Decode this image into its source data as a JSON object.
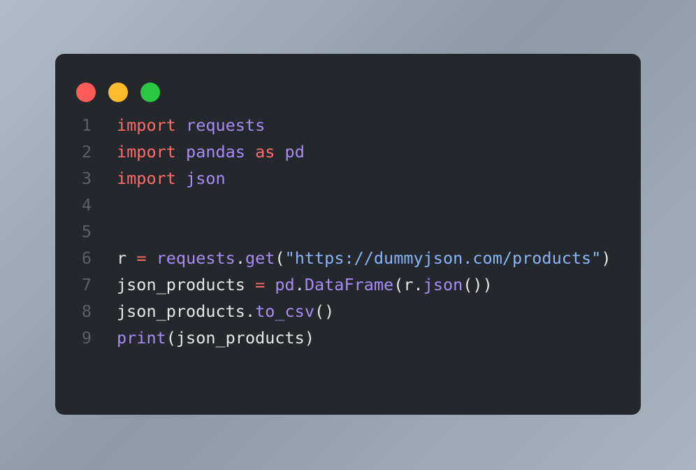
{
  "window": {
    "controls": [
      {
        "name": "close",
        "label": "Close",
        "color": "#fb5b57"
      },
      {
        "name": "minimize",
        "label": "Minimize",
        "color": "#fdbc2d"
      },
      {
        "name": "zoom",
        "label": "Zoom",
        "color": "#28c840"
      }
    ]
  },
  "theme": {
    "card_background": "#24282c",
    "page_background": "#9aa6b2",
    "gutter_color": "#596068",
    "text_color": "#e6e6e6",
    "keyword_color": "#ff6b6b",
    "module_color": "#a98bf5",
    "function_color": "#a98bf5",
    "string_color": "#8ab4f8"
  },
  "editor": {
    "language": "python",
    "line_numbers": [
      "1",
      "2",
      "3",
      "4",
      "5",
      "6",
      "7",
      "8",
      "9"
    ],
    "lines": [
      {
        "number": "1",
        "text": "import requests",
        "tokens": [
          {
            "t": "import",
            "c": "tok-kw"
          },
          {
            "t": " ",
            "c": "tok-plain"
          },
          {
            "t": "requests",
            "c": "tok-module"
          }
        ]
      },
      {
        "number": "2",
        "text": "import pandas as pd",
        "tokens": [
          {
            "t": "import",
            "c": "tok-kw"
          },
          {
            "t": " ",
            "c": "tok-plain"
          },
          {
            "t": "pandas",
            "c": "tok-module"
          },
          {
            "t": " ",
            "c": "tok-plain"
          },
          {
            "t": "as",
            "c": "tok-kw"
          },
          {
            "t": " ",
            "c": "tok-plain"
          },
          {
            "t": "pd",
            "c": "tok-module"
          }
        ]
      },
      {
        "number": "3",
        "text": "import json",
        "tokens": [
          {
            "t": "import",
            "c": "tok-kw"
          },
          {
            "t": " ",
            "c": "tok-plain"
          },
          {
            "t": "json",
            "c": "tok-module"
          }
        ]
      },
      {
        "number": "4",
        "text": "",
        "tokens": []
      },
      {
        "number": "5",
        "text": "",
        "tokens": []
      },
      {
        "number": "6",
        "text": "r = requests.get(\"https://dummyjson.com/products\")",
        "tokens": [
          {
            "t": "r",
            "c": "tok-plain"
          },
          {
            "t": " ",
            "c": "tok-plain"
          },
          {
            "t": "=",
            "c": "tok-op"
          },
          {
            "t": " ",
            "c": "tok-plain"
          },
          {
            "t": "requests",
            "c": "tok-module"
          },
          {
            "t": ".",
            "c": "tok-punct"
          },
          {
            "t": "get",
            "c": "tok-fn"
          },
          {
            "t": "(",
            "c": "tok-punct"
          },
          {
            "t": "\"https://dummyjson.com/products\"",
            "c": "tok-str"
          },
          {
            "t": ")",
            "c": "tok-punct"
          }
        ]
      },
      {
        "number": "7",
        "text": "json_products = pd.DataFrame(r.json())",
        "tokens": [
          {
            "t": "json_products",
            "c": "tok-plain"
          },
          {
            "t": " ",
            "c": "tok-plain"
          },
          {
            "t": "=",
            "c": "tok-op"
          },
          {
            "t": " ",
            "c": "tok-plain"
          },
          {
            "t": "pd",
            "c": "tok-module"
          },
          {
            "t": ".",
            "c": "tok-punct"
          },
          {
            "t": "DataFrame",
            "c": "tok-fn"
          },
          {
            "t": "(",
            "c": "tok-punct"
          },
          {
            "t": "r",
            "c": "tok-plain"
          },
          {
            "t": ".",
            "c": "tok-punct"
          },
          {
            "t": "json",
            "c": "tok-fn"
          },
          {
            "t": "()",
            "c": "tok-punct"
          },
          {
            "t": ")",
            "c": "tok-punct"
          }
        ]
      },
      {
        "number": "8",
        "text": "json_products.to_csv()",
        "tokens": [
          {
            "t": "json_products",
            "c": "tok-plain"
          },
          {
            "t": ".",
            "c": "tok-punct"
          },
          {
            "t": "to_csv",
            "c": "tok-fn"
          },
          {
            "t": "()",
            "c": "tok-punct"
          }
        ]
      },
      {
        "number": "9",
        "text": "print(json_products)",
        "tokens": [
          {
            "t": "print",
            "c": "tok-fn"
          },
          {
            "t": "(",
            "c": "tok-punct"
          },
          {
            "t": "json_products",
            "c": "tok-plain"
          },
          {
            "t": ")",
            "c": "tok-punct"
          }
        ]
      }
    ]
  }
}
